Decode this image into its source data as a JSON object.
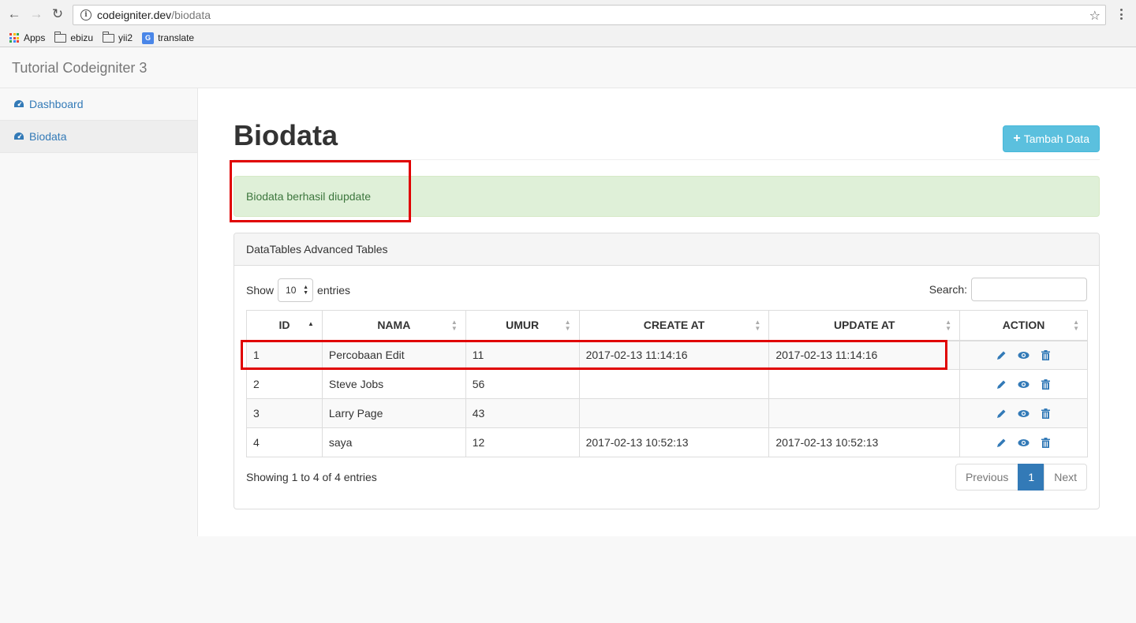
{
  "browser": {
    "url_domain": "codeigniter.dev",
    "url_path": "/biodata",
    "bookmarks": [
      {
        "label": "Apps",
        "icon": "apps-grid-icon"
      },
      {
        "label": "ebizu",
        "icon": "folder-icon"
      },
      {
        "label": "yii2",
        "icon": "folder-icon"
      },
      {
        "label": "translate",
        "icon": "translate-icon"
      }
    ]
  },
  "navbar": {
    "brand": "Tutorial Codeigniter 3"
  },
  "sidebar": {
    "items": [
      {
        "label": "Dashboard",
        "icon": "dashboard-icon",
        "active": false
      },
      {
        "label": "Biodata",
        "icon": "dashboard-icon",
        "active": true
      }
    ]
  },
  "page": {
    "title": "Biodata",
    "add_button": "Tambah Data",
    "alert": "Biodata berhasil diupdate"
  },
  "panel": {
    "heading": "DataTables Advanced Tables",
    "show_label": "Show",
    "entries_value": "10",
    "entries_label": "entries",
    "search_label": "Search:",
    "info": "Showing 1 to 4 of 4 entries",
    "pagination": {
      "previous": "Previous",
      "current": "1",
      "next": "Next"
    }
  },
  "table": {
    "columns": [
      "ID",
      "NAMA",
      "UMUR",
      "CREATE AT",
      "UPDATE AT",
      "ACTION"
    ],
    "rows": [
      {
        "id": "1",
        "nama": "Percobaan Edit",
        "umur": "11",
        "create_at": "2017-02-13 11:14:16",
        "update_at": "2017-02-13 11:14:16"
      },
      {
        "id": "2",
        "nama": "Steve Jobs",
        "umur": "56",
        "create_at": "",
        "update_at": ""
      },
      {
        "id": "3",
        "nama": "Larry Page",
        "umur": "43",
        "create_at": "",
        "update_at": ""
      },
      {
        "id": "4",
        "nama": "saya",
        "umur": "12",
        "create_at": "2017-02-13 10:52:13",
        "update_at": "2017-02-13 10:52:13"
      }
    ]
  },
  "colors": {
    "link": "#337ab7",
    "info_button": "#5bc0de",
    "alert_success_bg": "#dff0d8",
    "alert_success_text": "#3c763d",
    "highlight_box": "#e00000"
  }
}
